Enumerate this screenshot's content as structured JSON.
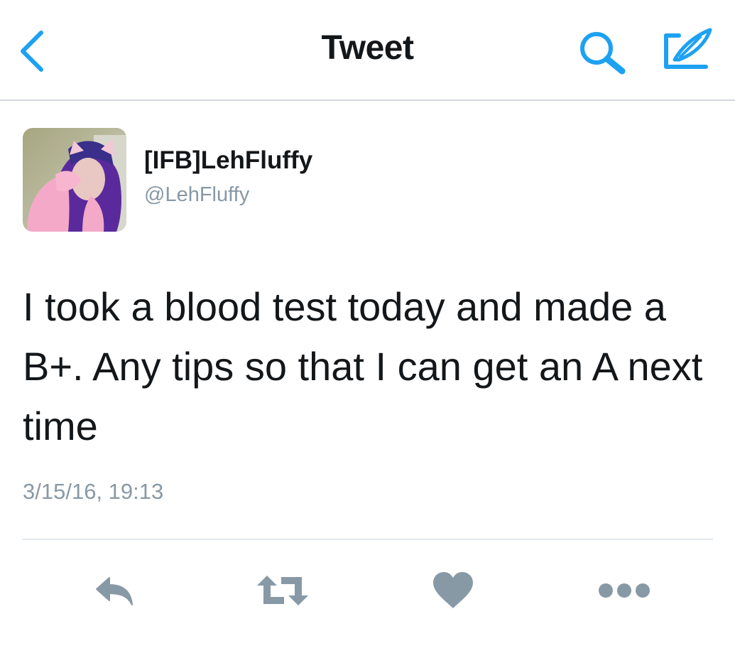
{
  "colors": {
    "accent": "#1da1f2",
    "muted": "#8899a6",
    "text": "#14171a",
    "divider": "#e1e8ed"
  },
  "nav": {
    "title": "Tweet",
    "back_icon": "chevron-left-icon",
    "search_icon": "search-icon",
    "compose_icon": "compose-icon"
  },
  "tweet": {
    "display_name": "[IFB]LehFluffy",
    "username": "@LehFluffy",
    "text": "I took a blood test today and made a B+. Any tips so that I can get an A next time",
    "timestamp": "3/15/16, 19:13"
  },
  "actions": [
    {
      "name": "reply",
      "icon": "reply-icon"
    },
    {
      "name": "retweet",
      "icon": "retweet-icon"
    },
    {
      "name": "like",
      "icon": "heart-icon"
    },
    {
      "name": "more",
      "icon": "more-icon"
    }
  ]
}
